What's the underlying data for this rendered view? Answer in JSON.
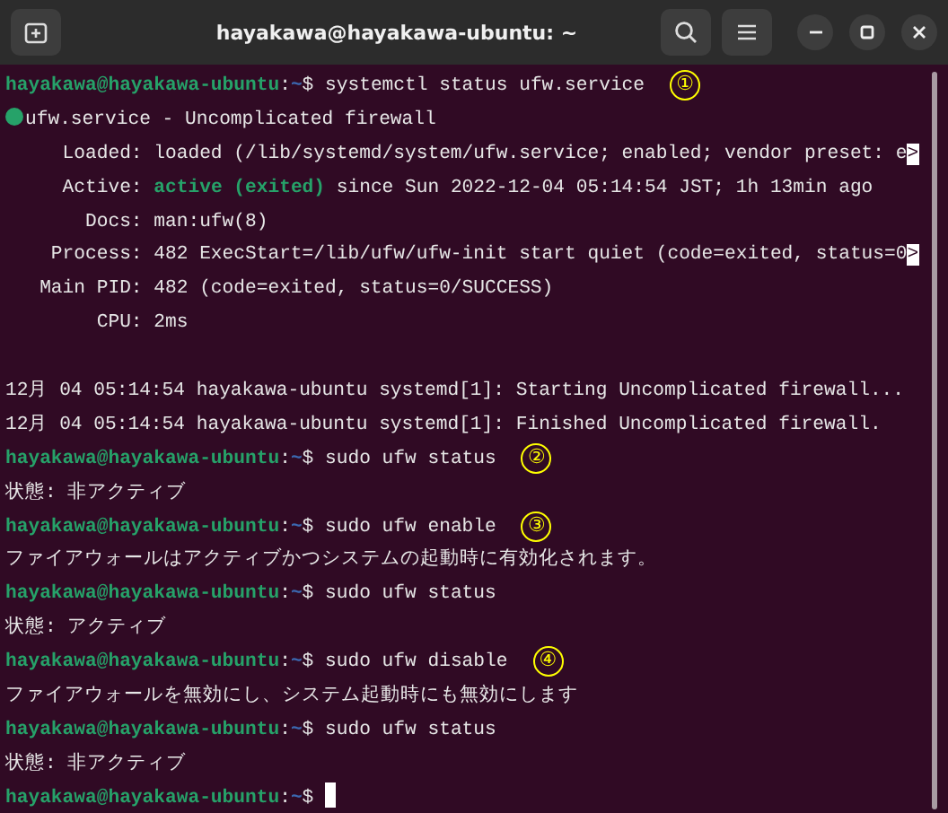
{
  "window": {
    "title": "hayakawa@hayakawa-ubuntu: ~"
  },
  "terminal": {
    "lines": [
      {
        "kind": "prompt",
        "user": "hayakawa@hayakawa-ubuntu",
        "separator": ":",
        "path": "~",
        "symbol": "$",
        "command": "systemctl status ufw.service",
        "annotation": "①",
        "cursor": false
      },
      {
        "kind": "service",
        "segments": [
          {
            "kind": "plain",
            "text": "ufw.service - Uncomplicated firewall"
          }
        ]
      },
      {
        "kind": "output",
        "segments": [
          {
            "kind": "plain",
            "text": "     Loaded: loaded (/lib/systemd/system/ufw.service; enabled; vendor preset: e"
          },
          {
            "kind": "overflow",
            "text": ">"
          }
        ]
      },
      {
        "kind": "output",
        "segments": [
          {
            "kind": "plain",
            "text": "     Active: "
          },
          {
            "kind": "status",
            "text": "active (exited)"
          },
          {
            "kind": "plain",
            "text": " since Sun 2022-12-04 05:14:54 JST; 1h 13min ago"
          }
        ]
      },
      {
        "kind": "output",
        "segments": [
          {
            "kind": "plain",
            "text": "       Docs: man:ufw(8)"
          }
        ]
      },
      {
        "kind": "output",
        "segments": [
          {
            "kind": "plain",
            "text": "    Process: 482 ExecStart=/lib/ufw/ufw-init start quiet (code=exited, status=0"
          },
          {
            "kind": "overflow",
            "text": ">"
          }
        ]
      },
      {
        "kind": "output",
        "segments": [
          {
            "kind": "plain",
            "text": "   Main PID: 482 (code=exited, status=0/SUCCESS)"
          }
        ]
      },
      {
        "kind": "output",
        "segments": [
          {
            "kind": "plain",
            "text": "        CPU: 2ms"
          }
        ]
      },
      {
        "kind": "blank"
      },
      {
        "kind": "output",
        "segments": [
          {
            "kind": "plain",
            "text": "12月 04 05:14:54 hayakawa-ubuntu systemd[1]: Starting Uncomplicated firewall..."
          }
        ]
      },
      {
        "kind": "output",
        "segments": [
          {
            "kind": "plain",
            "text": "12月 04 05:14:54 hayakawa-ubuntu systemd[1]: Finished Uncomplicated firewall."
          }
        ]
      },
      {
        "kind": "prompt",
        "user": "hayakawa@hayakawa-ubuntu",
        "separator": ":",
        "path": "~",
        "symbol": "$",
        "command": "sudo ufw status",
        "annotation": "②",
        "cursor": false
      },
      {
        "kind": "output",
        "segments": [
          {
            "kind": "plain",
            "text": "状態: 非アクティブ"
          }
        ]
      },
      {
        "kind": "prompt",
        "user": "hayakawa@hayakawa-ubuntu",
        "separator": ":",
        "path": "~",
        "symbol": "$",
        "command": "sudo ufw enable",
        "annotation": "③",
        "cursor": false
      },
      {
        "kind": "output",
        "segments": [
          {
            "kind": "plain",
            "text": "ファイアウォールはアクティブかつシステムの起動時に有効化されます。"
          }
        ]
      },
      {
        "kind": "prompt",
        "user": "hayakawa@hayakawa-ubuntu",
        "separator": ":",
        "path": "~",
        "symbol": "$",
        "command": "sudo ufw status",
        "cursor": false
      },
      {
        "kind": "output",
        "segments": [
          {
            "kind": "plain",
            "text": "状態: アクティブ"
          }
        ]
      },
      {
        "kind": "prompt",
        "user": "hayakawa@hayakawa-ubuntu",
        "separator": ":",
        "path": "~",
        "symbol": "$",
        "command": "sudo ufw disable",
        "annotation": "④",
        "cursor": false
      },
      {
        "kind": "output",
        "segments": [
          {
            "kind": "plain",
            "text": "ファイアウォールを無効にし、システム起動時にも無効にします"
          }
        ]
      },
      {
        "kind": "prompt",
        "user": "hayakawa@hayakawa-ubuntu",
        "separator": ":",
        "path": "~",
        "symbol": "$",
        "command": "sudo ufw status",
        "cursor": false
      },
      {
        "kind": "output",
        "segments": [
          {
            "kind": "plain",
            "text": "状態: 非アクティブ"
          }
        ]
      },
      {
        "kind": "prompt",
        "user": "hayakawa@hayakawa-ubuntu",
        "separator": ":",
        "path": "~",
        "symbol": "$",
        "cursor": true
      }
    ]
  }
}
